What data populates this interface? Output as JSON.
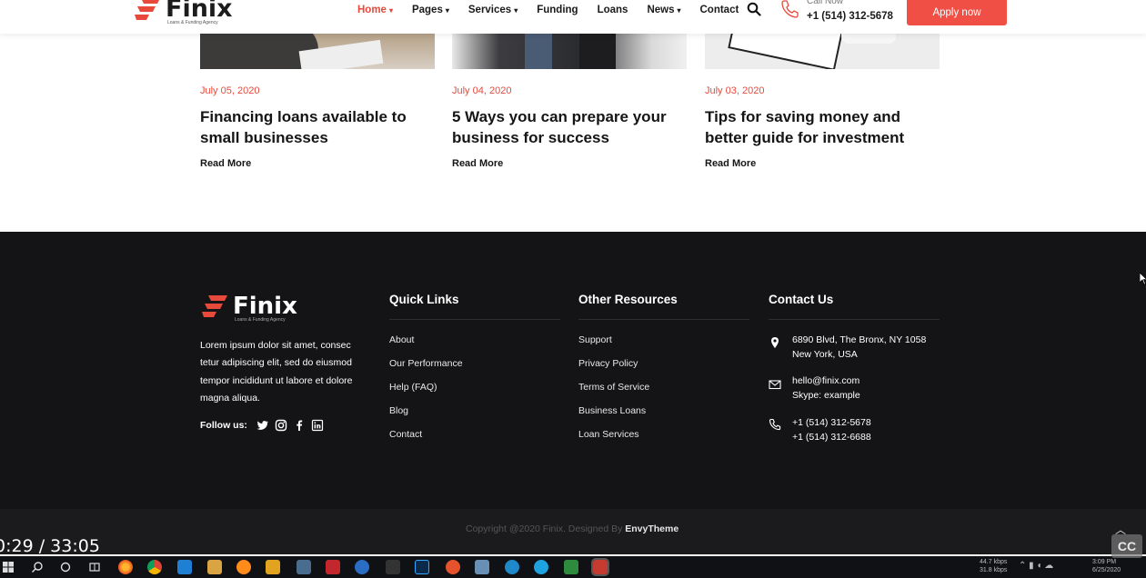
{
  "header": {
    "logo_text": "Finix",
    "logo_tagline": "Loans & Funding Agency",
    "nav": [
      {
        "label": "Home",
        "has_dropdown": true,
        "active": true
      },
      {
        "label": "Pages",
        "has_dropdown": true,
        "active": false
      },
      {
        "label": "Services",
        "has_dropdown": true,
        "active": false
      },
      {
        "label": "Funding",
        "has_dropdown": false,
        "active": false
      },
      {
        "label": "Loans",
        "has_dropdown": false,
        "active": false
      },
      {
        "label": "News",
        "has_dropdown": true,
        "active": false
      },
      {
        "label": "Contact",
        "has_dropdown": false,
        "active": false
      }
    ],
    "search_icon": "search-icon",
    "call_label": "Call Now",
    "call_number": "+1 (514) 312-5678",
    "apply_label": "Apply now"
  },
  "blog": [
    {
      "date": "July 05, 2020",
      "title": "Financing loans available to small businesses",
      "more": "Read More"
    },
    {
      "date": "July 04, 2020",
      "title": "5 Ways you can prepare your business for success",
      "more": "Read More"
    },
    {
      "date": "July 03, 2020",
      "title": "Tips for saving money and better guide for investment",
      "more": "Read More"
    }
  ],
  "footer": {
    "logo_text": "Finix",
    "logo_tagline": "Loans & Funding Agency",
    "about": "Lorem ipsum dolor sit amet, consec tetur adipiscing elit, sed do eiusmod tempor incididunt ut labore et dolore magna aliqua.",
    "follow_label": "Follow us:",
    "social_icons": [
      "twitter-icon",
      "instagram-icon",
      "facebook-icon",
      "linkedin-icon"
    ],
    "quick_links_title": "Quick Links",
    "quick_links": [
      "About",
      "Our Performance",
      "Help (FAQ)",
      "Blog",
      "Contact"
    ],
    "resources_title": "Other Resources",
    "resources": [
      "Support",
      "Privacy Policy",
      "Terms of Service",
      "Business Loans",
      "Loan Services"
    ],
    "contact_title": "Contact Us",
    "contact": {
      "address_line1": "6890 Blvd, The Bronx, NY 1058",
      "address_line2": "New York, USA",
      "email": "hello@finix.com",
      "skype": "Skype: example",
      "phone1": "+1 (514) 312-5678",
      "phone2": "+1 (514) 312-6688"
    },
    "copyright": "Copyright @2020 Finix. Designed By",
    "designer": "EnvyTheme"
  },
  "video": {
    "time": "0:29 / 33:05",
    "cc_label": "CC"
  },
  "taskbar": {
    "net_down": "44.7 kbps",
    "net_up": "31.8 kbps",
    "clock_time": "3:09 PM",
    "clock_date": "6/25/2020"
  },
  "colors": {
    "accent": "#e74a3b",
    "footer_bg": "#141416",
    "apply_bg": "#ef4f45"
  }
}
